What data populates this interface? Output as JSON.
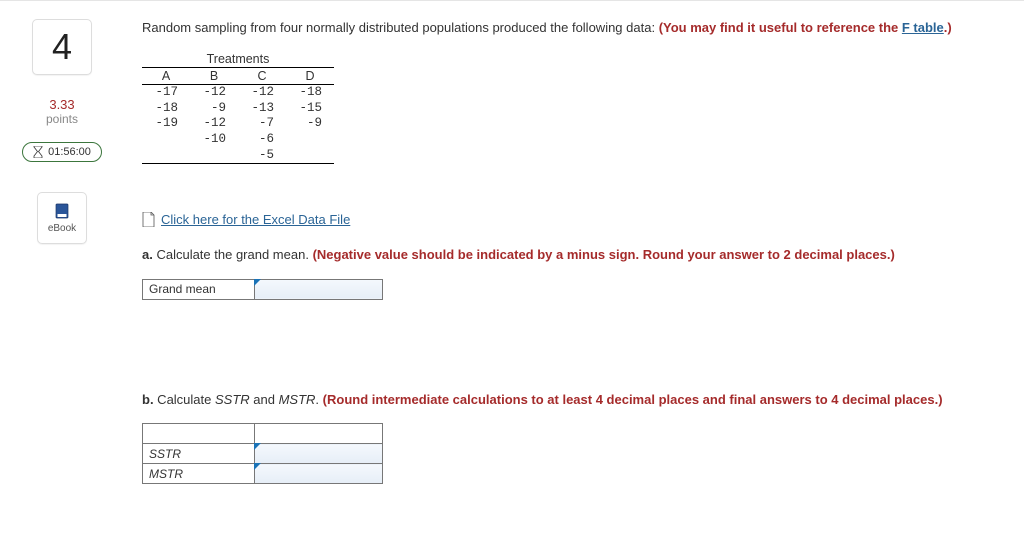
{
  "sidebar": {
    "question_number": "4",
    "points_value": "3.33",
    "points_label": "points",
    "timer": "01:56:00",
    "ebook_label": "eBook"
  },
  "prompt": {
    "text_start": "Random sampling from four normally distributed populations produced the following data: ",
    "hint_prefix": "(You may find it useful to reference the ",
    "f_link": "F table",
    "hint_suffix": ".)"
  },
  "table": {
    "title": "Treatments",
    "columns": [
      "A",
      "B",
      "C",
      "D"
    ],
    "rows": [
      [
        "-17",
        "-12",
        "-12",
        "-18"
      ],
      [
        "-18",
        "-9",
        "-13",
        "-15"
      ],
      [
        "-19",
        "-12",
        "-7",
        "-9"
      ],
      [
        "",
        "-10",
        "-6",
        ""
      ],
      [
        "",
        "",
        "-5",
        ""
      ]
    ]
  },
  "excel_link": "Click here for the Excel Data File",
  "part_a": {
    "label": "a.",
    "text": " Calculate the grand mean. ",
    "hint": "(Negative value should be indicated by a minus sign. Round your answer to 2 decimal places.)",
    "field_label": "Grand mean"
  },
  "part_b": {
    "label": "b.",
    "text_pre": " Calculate ",
    "sstr": "SSTR",
    "and": " and ",
    "mstr": "MSTR",
    "period": ". ",
    "hint": "(Round intermediate calculations to at least 4 decimal places and final answers to 4 decimal places.)",
    "field1": "SSTR",
    "field2": "MSTR"
  }
}
